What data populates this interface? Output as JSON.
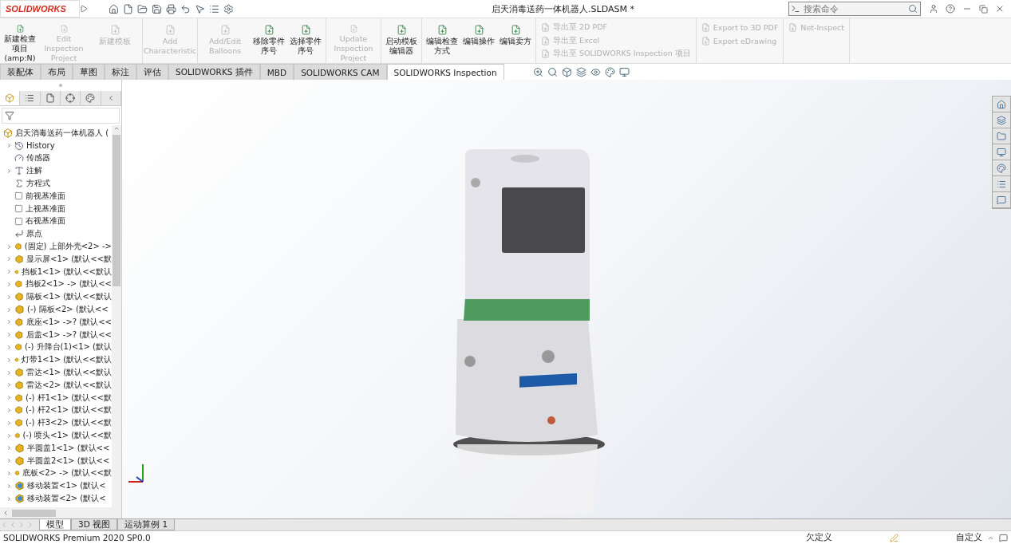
{
  "title_bar": {
    "logo": "SOLIDWORKS",
    "document_title": "启天消毒送药一体机器人.SLDASM *",
    "search_placeholder": "搜索命令"
  },
  "ribbon": {
    "groups": [
      {
        "kind": "large",
        "buttons": [
          {
            "label": "新建检查项目(amp:N)",
            "disabled": false
          },
          {
            "label": "Edit Inspection Project",
            "disabled": true
          },
          {
            "label": "新建模板",
            "disabled": true
          }
        ]
      },
      {
        "kind": "large",
        "buttons": [
          {
            "label": "Add Characteristic",
            "disabled": true
          }
        ]
      },
      {
        "kind": "large",
        "buttons": [
          {
            "label": "Add/Edit Balloons",
            "disabled": true
          },
          {
            "label": "移除零件序号",
            "disabled": false
          },
          {
            "label": "选择零件序号",
            "disabled": false
          }
        ]
      },
      {
        "kind": "large",
        "buttons": [
          {
            "label": "Update Inspection Project",
            "disabled": true
          }
        ]
      },
      {
        "kind": "large",
        "buttons": [
          {
            "label": "启动模板编辑器",
            "disabled": false
          }
        ]
      },
      {
        "kind": "large",
        "buttons": [
          {
            "label": "编辑检查方式",
            "disabled": false
          },
          {
            "label": "编辑操作",
            "disabled": false
          },
          {
            "label": "编辑卖方",
            "disabled": false
          }
        ]
      },
      {
        "kind": "small",
        "buttons": [
          {
            "label": "导出至 2D PDF",
            "disabled": true
          },
          {
            "label": "导出至 Excel",
            "disabled": true
          },
          {
            "label": "导出至 SOLIDWORKS Inspection 项目",
            "disabled": true
          }
        ]
      },
      {
        "kind": "small",
        "buttons": [
          {
            "label": "Export to 3D PDF",
            "disabled": true
          },
          {
            "label": "Export eDrawing",
            "disabled": true
          }
        ]
      },
      {
        "kind": "small",
        "buttons": [
          {
            "label": "Net-Inspect",
            "disabled": true
          }
        ]
      }
    ]
  },
  "tabs": [
    {
      "label": "装配体",
      "selected": false
    },
    {
      "label": "布局",
      "selected": false
    },
    {
      "label": "草图",
      "selected": false
    },
    {
      "label": "标注",
      "selected": false
    },
    {
      "label": "评估",
      "selected": false
    },
    {
      "label": "SOLIDWORKS 插件",
      "selected": false
    },
    {
      "label": "MBD",
      "selected": false
    },
    {
      "label": "SOLIDWORKS CAM",
      "selected": false
    },
    {
      "label": "SOLIDWORKS Inspection",
      "selected": true
    }
  ],
  "tree": {
    "root": "启天消毒送药一体机器人 (",
    "items": [
      {
        "kind": "history",
        "label": "History",
        "expandable": true
      },
      {
        "kind": "sensor",
        "label": "传感器",
        "expandable": false
      },
      {
        "kind": "annotation",
        "label": "注解",
        "expandable": true
      },
      {
        "kind": "equation",
        "label": "方程式",
        "expandable": false
      },
      {
        "kind": "plane",
        "label": "前视基准面",
        "expandable": false
      },
      {
        "kind": "plane",
        "label": "上视基准面",
        "expandable": false
      },
      {
        "kind": "plane",
        "label": "右视基准面",
        "expandable": false
      },
      {
        "kind": "origin",
        "label": "原点",
        "expandable": false
      },
      {
        "kind": "part",
        "label": "(固定) 上部外壳<2> ->",
        "expandable": true
      },
      {
        "kind": "part",
        "label": "显示屏<1> (默认<<默",
        "expandable": true
      },
      {
        "kind": "part",
        "label": "挡板1<1> (默认<<默认",
        "expandable": true
      },
      {
        "kind": "part",
        "label": "挡板2<1> -> (默认<<",
        "expandable": true
      },
      {
        "kind": "part",
        "label": "隔板<1> (默认<<默认",
        "expandable": true
      },
      {
        "kind": "part",
        "label": "(-) 隔板<2> (默认<<",
        "expandable": true
      },
      {
        "kind": "part",
        "label": "底座<1> ->? (默认<<",
        "expandable": true
      },
      {
        "kind": "part",
        "label": "后盖<1> ->? (默认<<",
        "expandable": true
      },
      {
        "kind": "part",
        "label": "(-) 升降台(1)<1> (默认",
        "expandable": true
      },
      {
        "kind": "part",
        "label": "灯带1<1> (默认<<默认",
        "expandable": true
      },
      {
        "kind": "part",
        "label": "雷达<1> (默认<<默认",
        "expandable": true
      },
      {
        "kind": "part",
        "label": "雷达<2> (默认<<默认",
        "expandable": true
      },
      {
        "kind": "part",
        "label": "(-) 杆1<1> (默认<<默",
        "expandable": true
      },
      {
        "kind": "part",
        "label": "(-) 杆2<1> (默认<<默",
        "expandable": true
      },
      {
        "kind": "part",
        "label": "(-) 杆3<2> (默认<<默",
        "expandable": true
      },
      {
        "kind": "part",
        "label": "(-) 喷头<1> (默认<<默",
        "expandable": true
      },
      {
        "kind": "part",
        "label": "半圆盖1<1> (默认<<",
        "expandable": true
      },
      {
        "kind": "part",
        "label": "半圆盖2<1> (默认<<",
        "expandable": true
      },
      {
        "kind": "part",
        "label": "底板<2> -> (默认<<默",
        "expandable": true
      },
      {
        "kind": "assembly",
        "label": "移动装置<1> (默认<",
        "expandable": true
      },
      {
        "kind": "assembly",
        "label": "移动装置<2> (默认<",
        "expandable": true
      }
    ]
  },
  "bottom_tabs": [
    {
      "label": "模型",
      "selected": true
    },
    {
      "label": "3D 视图",
      "selected": false
    },
    {
      "label": "运动算例 1",
      "selected": false
    }
  ],
  "status_bar": {
    "product": "SOLIDWORKS Premium 2020 SP0.0",
    "state": "欠定义",
    "units": "自定义"
  }
}
